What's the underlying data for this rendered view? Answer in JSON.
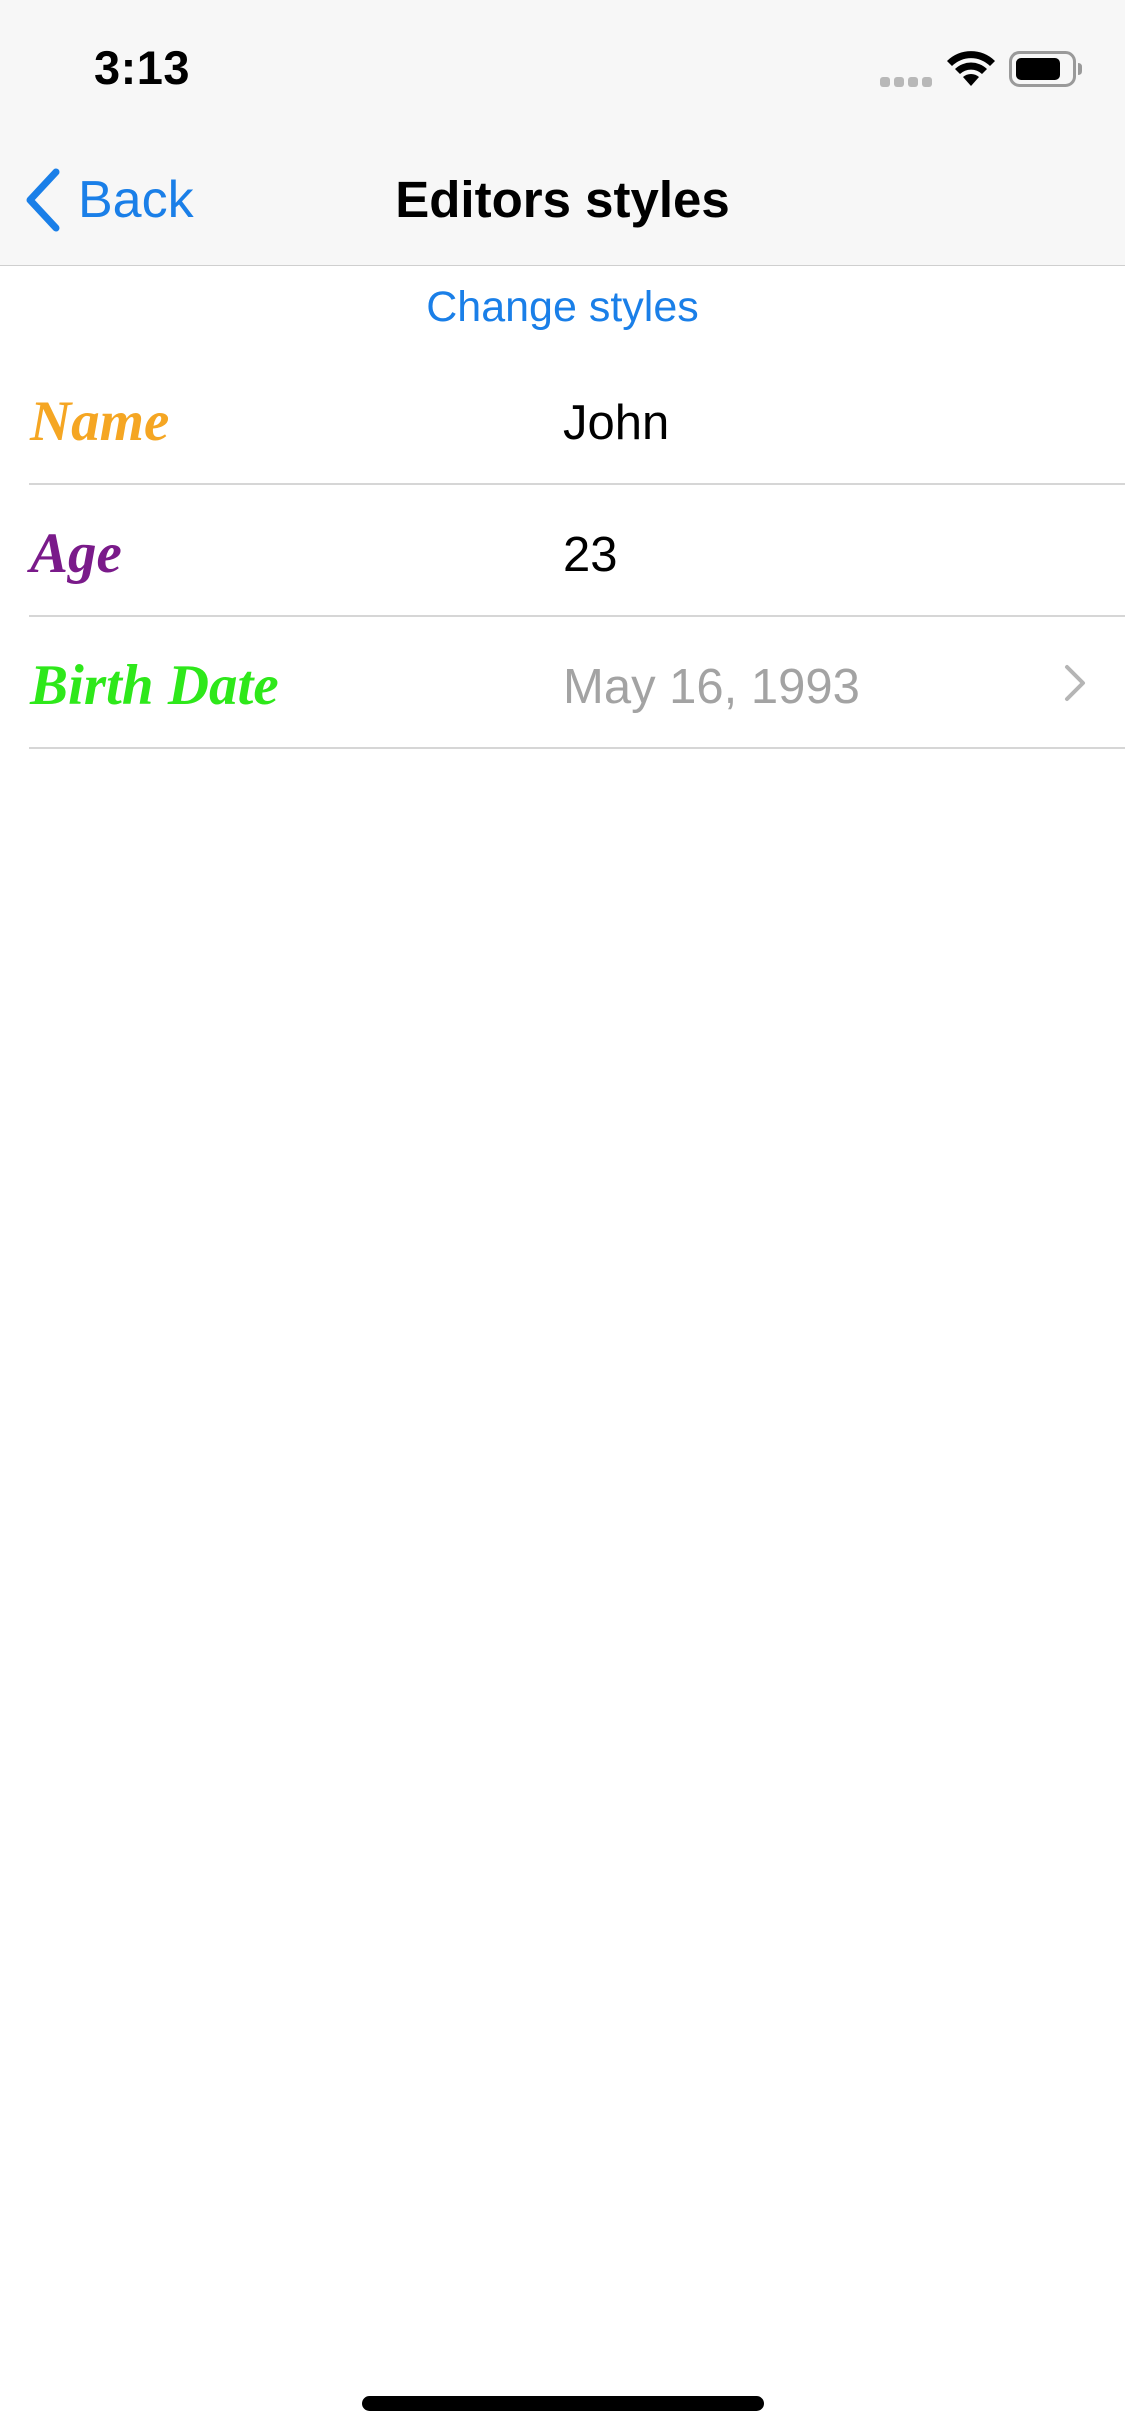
{
  "status_bar": {
    "time": "3:13"
  },
  "nav": {
    "back_label": "Back",
    "title": "Editors styles"
  },
  "actions": {
    "change_styles": "Change styles"
  },
  "form": {
    "rows": [
      {
        "label": "Name",
        "label_color": "#f5a623",
        "value": "John",
        "value_style": "normal"
      },
      {
        "label": "Age",
        "label_color": "#7a1a8a",
        "value": "23",
        "value_style": "normal"
      },
      {
        "label": "Birth Date",
        "label_color": "#2ee81a",
        "value": "May 16, 1993",
        "value_style": "placeholder",
        "disclosure": "chevron-right-icon"
      }
    ]
  },
  "colors": {
    "accent": "#1a7fe8",
    "nav_background": "#f7f7f7",
    "placeholder": "#a3a3a3"
  },
  "icons": {
    "back": "chevron-left-icon",
    "signal": "cellular-signal-icon",
    "wifi": "wifi-icon",
    "battery": "battery-icon"
  }
}
